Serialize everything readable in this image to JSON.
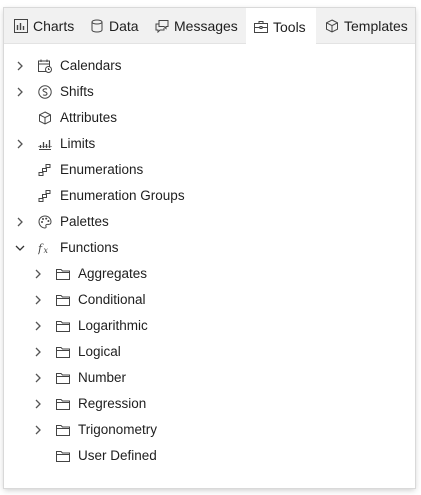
{
  "tabs": [
    {
      "label": "Charts",
      "icon": "bar-chart-icon"
    },
    {
      "label": "Data",
      "icon": "database-icon"
    },
    {
      "label": "Messages",
      "icon": "messages-icon"
    },
    {
      "label": "Tools",
      "icon": "toolbox-icon",
      "active": true
    },
    {
      "label": "Templates",
      "icon": "cube-icon"
    }
  ],
  "tree": [
    {
      "label": "Calendars",
      "icon": "calendar-icon",
      "level": 0,
      "expander": "collapsed"
    },
    {
      "label": "Shifts",
      "icon": "shift-icon",
      "level": 0,
      "expander": "collapsed"
    },
    {
      "label": "Attributes",
      "icon": "cube-icon",
      "level": 0,
      "expander": "none"
    },
    {
      "label": "Limits",
      "icon": "limits-icon",
      "level": 0,
      "expander": "collapsed"
    },
    {
      "label": "Enumerations",
      "icon": "enumeration-icon",
      "level": 0,
      "expander": "none"
    },
    {
      "label": "Enumeration Groups",
      "icon": "enumeration-icon",
      "level": 0,
      "expander": "none"
    },
    {
      "label": "Palettes",
      "icon": "palette-icon",
      "level": 0,
      "expander": "collapsed"
    },
    {
      "label": "Functions",
      "icon": "function-icon",
      "level": 0,
      "expander": "expanded"
    },
    {
      "label": "Aggregates",
      "icon": "folder-icon",
      "level": 1,
      "expander": "collapsed"
    },
    {
      "label": "Conditional",
      "icon": "folder-icon",
      "level": 1,
      "expander": "collapsed"
    },
    {
      "label": "Logarithmic",
      "icon": "folder-icon",
      "level": 1,
      "expander": "collapsed"
    },
    {
      "label": "Logical",
      "icon": "folder-icon",
      "level": 1,
      "expander": "collapsed"
    },
    {
      "label": "Number",
      "icon": "folder-icon",
      "level": 1,
      "expander": "collapsed"
    },
    {
      "label": "Regression",
      "icon": "folder-icon",
      "level": 1,
      "expander": "collapsed"
    },
    {
      "label": "Trigonometry",
      "icon": "folder-icon",
      "level": 1,
      "expander": "collapsed"
    },
    {
      "label": "User Defined",
      "icon": "folder-icon",
      "level": 1,
      "expander": "none"
    }
  ]
}
